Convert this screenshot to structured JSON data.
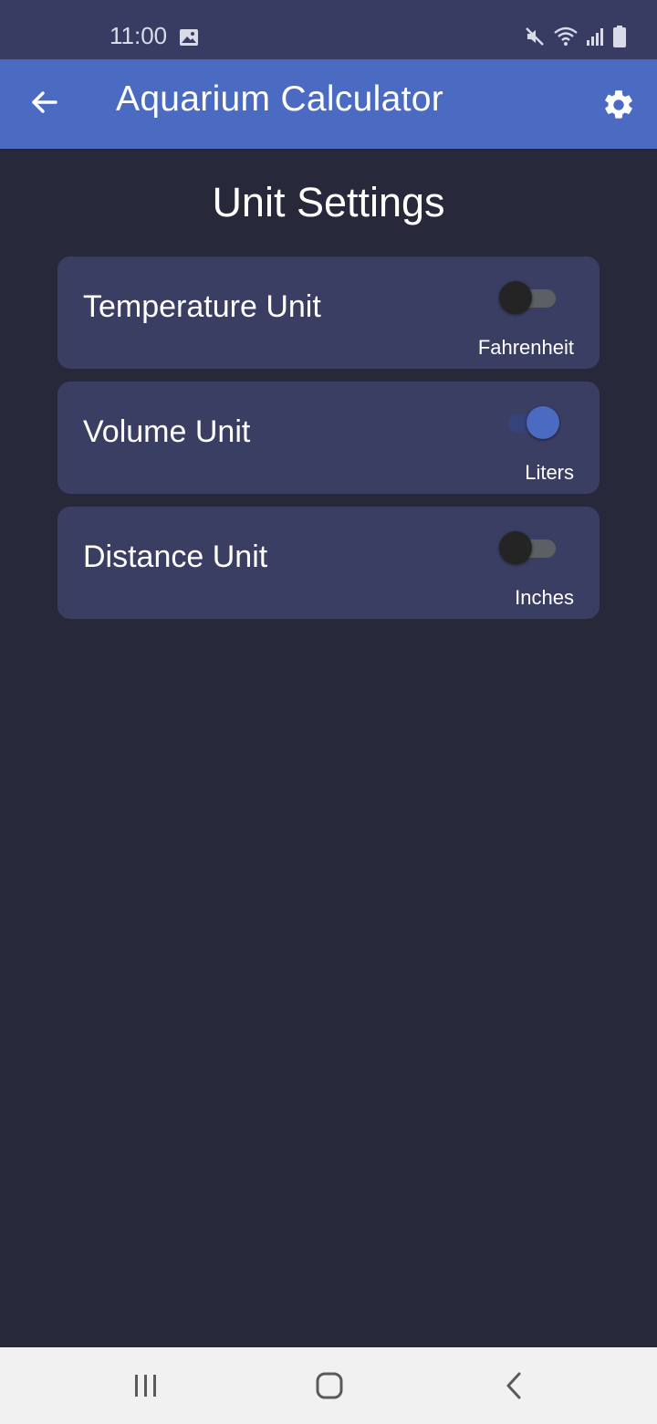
{
  "status": {
    "time": "11:00"
  },
  "appbar": {
    "title": "Aquarium Calculator"
  },
  "page": {
    "title": "Unit Settings"
  },
  "settings": [
    {
      "label": "Temperature Unit",
      "value": "Fahrenheit",
      "enabled": false
    },
    {
      "label": "Volume Unit",
      "value": "Liters",
      "enabled": true
    },
    {
      "label": "Distance Unit",
      "value": "Inches",
      "enabled": false
    }
  ],
  "icons": {
    "back": "arrow-left-icon",
    "settings": "gear-icon",
    "nav_recents": "recents-icon",
    "nav_home": "home-icon",
    "nav_back": "chevron-left-icon"
  },
  "colors": {
    "appbar": "#4a6bc1",
    "background": "#272839",
    "card": "#3b3e63",
    "switch_on": "#4a6bc1"
  }
}
